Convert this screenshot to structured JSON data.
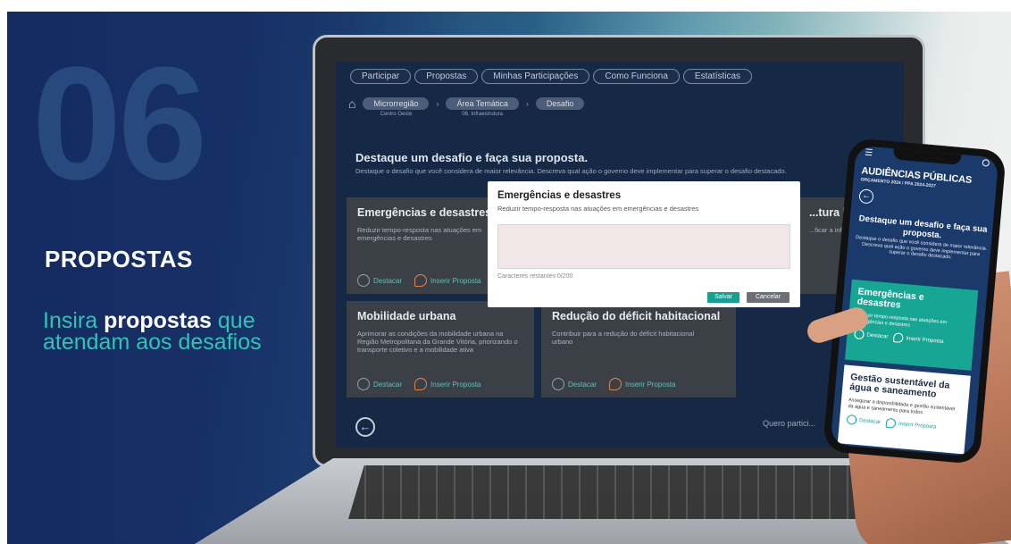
{
  "slide": {
    "number": "06",
    "title": "PROPOSTAS",
    "tagline_part1": "Insira ",
    "tagline_highlight": "propostas",
    "tagline_part2": " que atendam aos desafios"
  },
  "laptop": {
    "nav_tabs": [
      "Participar",
      "Propostas",
      "Minhas Participações",
      "Como Funciona",
      "Estatísticas"
    ],
    "breadcrumb": [
      {
        "label": "Microrregião",
        "sub": "Centro Oeste"
      },
      {
        "label": "Área Temática",
        "sub": "06. Infraestrutura"
      },
      {
        "label": "Desafio",
        "sub": ""
      }
    ],
    "headline": "Destaque um desafio e faça sua proposta.",
    "subheadline": "Destaque o desafio que você considera de maior relevância. Descreva qual ação o governo deve implementar para superar o desafio destacado.",
    "cards": [
      {
        "title": "Emergências e desastres",
        "text": "Reduzir tempo-resposta nas atuações em emergências e desastres",
        "highlight_label": "Destacar",
        "propose_label": "Inserir Proposta"
      },
      {
        "title": "...tura lo...",
        "text": "...ficar a infr...",
        "highlight_label": "",
        "propose_label": ""
      },
      {
        "title": "Mobilidade urbana",
        "text": "Aprimorar as condições da mobilidade urbana na Região Metropolitana da Grande Vitória, priorizando o transporte coletivo e a mobilidade ativa",
        "highlight_label": "Destacar",
        "propose_label": "Inserir Proposta"
      },
      {
        "title": "Redução do déficit habitacional",
        "text": "Contribuir para a redução do déficit habitacional urbano",
        "highlight_label": "Destacar",
        "propose_label": "Inserir Proposta"
      }
    ],
    "footer_link": "Quero partici...",
    "modal": {
      "title": "Emergências e desastres",
      "subtitle": "Reduzir tempo-resposta nas atuações em emergências e desastres",
      "textarea_value": "",
      "counter": "Caracteres restantes 0/200",
      "save_label": "Salvar",
      "cancel_label": "Cancelar"
    }
  },
  "phone": {
    "brand": "AUDIÊNCIAS PÚBLICAS",
    "brand_sub": "ORÇAMENTO 2024 / PPA 2024-2027",
    "title": "Destaque um desafio e faça sua proposta.",
    "subtitle": "Destaque o desafio que você considera de maior relevância. Descreva qual ação o governo deve implementar para superar o desafio destacado.",
    "cards": [
      {
        "title": "Emergências e desastres",
        "text": "Reduzir tempo-resposta nas atuações em emergências e desastres",
        "highlight_label": "Destacar",
        "propose_label": "Inserir Proposta"
      },
      {
        "title": "Gestão sustentável da água e saneamento",
        "text": "Assegurar a disponibilidade e gestão sustentável da água e saneamento para todos",
        "highlight_label": "Destacar",
        "propose_label": "Inserir Proposta"
      }
    ]
  },
  "colors": {
    "accent": "#16a08f",
    "navy": "#1b3d78",
    "tagline": "#2ec4b6"
  }
}
